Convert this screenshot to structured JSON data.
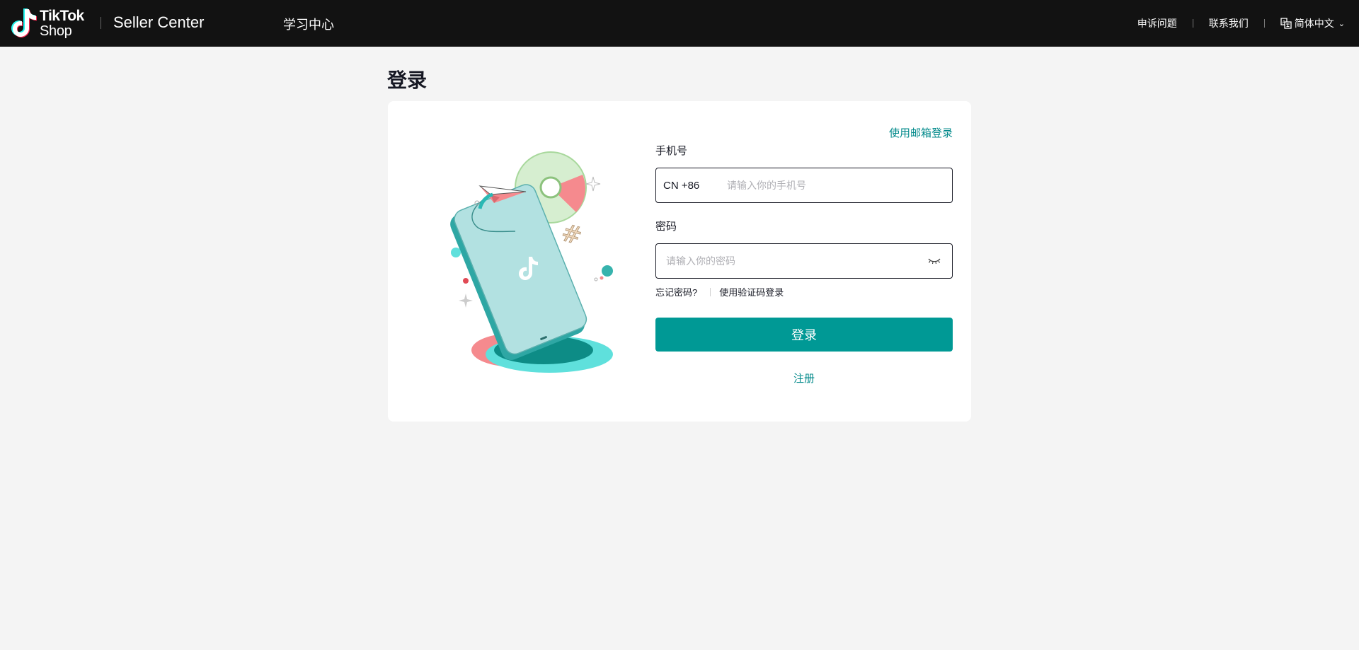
{
  "header": {
    "logo": {
      "line1": "TikTok",
      "line2": "Shop"
    },
    "brand": "Seller Center",
    "nav_learning": "学习中心",
    "appeal": "申诉问题",
    "contact": "联系我们",
    "language": "简体中文"
  },
  "page": {
    "title": "登录"
  },
  "form": {
    "alt_login": "使用邮箱登录",
    "phone_label": "手机号",
    "country_code": "CN +86",
    "phone_placeholder": "请输入你的手机号",
    "password_label": "密码",
    "password_placeholder": "请输入你的密码",
    "forgot_password": "忘记密码?",
    "code_login": "使用验证码登录",
    "login_button": "登录",
    "register": "注册"
  },
  "colors": {
    "accent": "#009995",
    "link": "#00898a",
    "topbar": "#121212",
    "background": "#f4f4f4"
  },
  "icons": [
    "tiktok-logo-icon",
    "translate-icon",
    "chevron-down-icon",
    "eye-closed-icon"
  ]
}
